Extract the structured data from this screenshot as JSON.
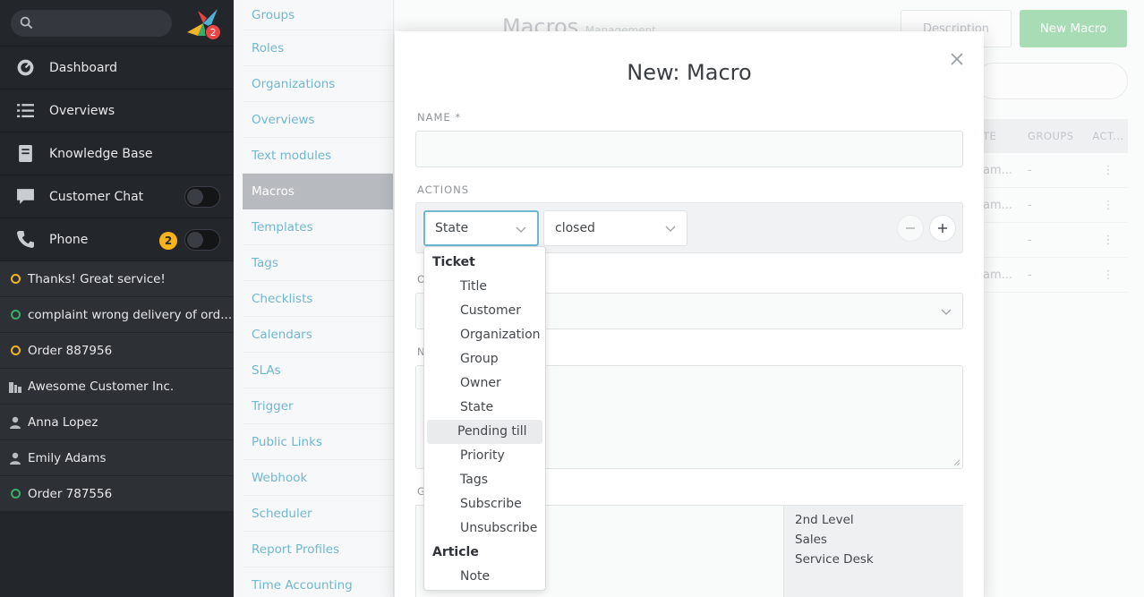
{
  "nav": {
    "logo_badge": "2",
    "items": [
      {
        "label": "Dashboard",
        "icon": "dashboard-icon"
      },
      {
        "label": "Overviews",
        "icon": "list-icon"
      },
      {
        "label": "Knowledge Base",
        "icon": "book-icon"
      },
      {
        "label": "Customer Chat",
        "icon": "chat-icon"
      },
      {
        "label": "Phone",
        "icon": "phone-icon",
        "badge": "2"
      }
    ],
    "tasks": [
      {
        "label": "Thanks! Great service!",
        "icon": "ring-yellow"
      },
      {
        "label": "complaint wrong delivery of ord...",
        "icon": "ring-green"
      },
      {
        "label": "Order 887956",
        "icon": "ring-yellow"
      },
      {
        "label": "Awesome Customer Inc.",
        "icon": "organization-icon"
      },
      {
        "label": "Anna Lopez",
        "icon": "user-icon"
      },
      {
        "label": "Emily Adams",
        "icon": "user-icon"
      },
      {
        "label": "Order 787556",
        "icon": "ring-green"
      }
    ]
  },
  "settings": {
    "items": [
      "Groups",
      "Roles",
      "Organizations",
      "Overviews",
      "Text modules",
      "Macros",
      "Templates",
      "Tags",
      "Checklists",
      "Calendars",
      "SLAs",
      "Trigger",
      "Public Links",
      "Webhook",
      "Scheduler",
      "Report Profiles",
      "Time Accounting"
    ],
    "active": "Macros"
  },
  "background": {
    "title": "Macros",
    "subtitle": "Management",
    "description_button": "Description",
    "new_button": "New Macro",
    "table": {
      "headers": [
        "TE",
        "GROUPS",
        "ACT..."
      ],
      "rows": [
        [
          "am...",
          "-",
          "⋮"
        ],
        [
          "am...",
          "-",
          "⋮"
        ],
        [
          "",
          "-",
          "⋮"
        ],
        [
          "am...",
          "-",
          "⋮"
        ]
      ]
    }
  },
  "modal": {
    "title": "New: Macro",
    "name_label": "NAME *",
    "actions_label": "ACTIONS",
    "action_attribute": "State",
    "action_value": "closed",
    "cond_label_initial": "O",
    "note_label_initial": "N",
    "groups_label_initial": "G",
    "groups_selected": [
      "2nd Level",
      "Sales",
      "Service Desk"
    ]
  },
  "dropdown": {
    "groups": [
      {
        "label": "Ticket",
        "options": [
          "Title",
          "Customer",
          "Organization",
          "Group",
          "Owner",
          "State",
          "Pending till",
          "Priority",
          "Tags",
          "Subscribe",
          "Unsubscribe"
        ]
      },
      {
        "label": "Article",
        "options": [
          "Note"
        ]
      }
    ],
    "highlighted": "Pending till"
  },
  "colors": {
    "nav_bg": "#23262b",
    "accent_blue": "#6fb7d3",
    "badge_yellow": "#f7b41a",
    "status_green": "#38ad69",
    "new_button_green": "#a8dcb5"
  }
}
